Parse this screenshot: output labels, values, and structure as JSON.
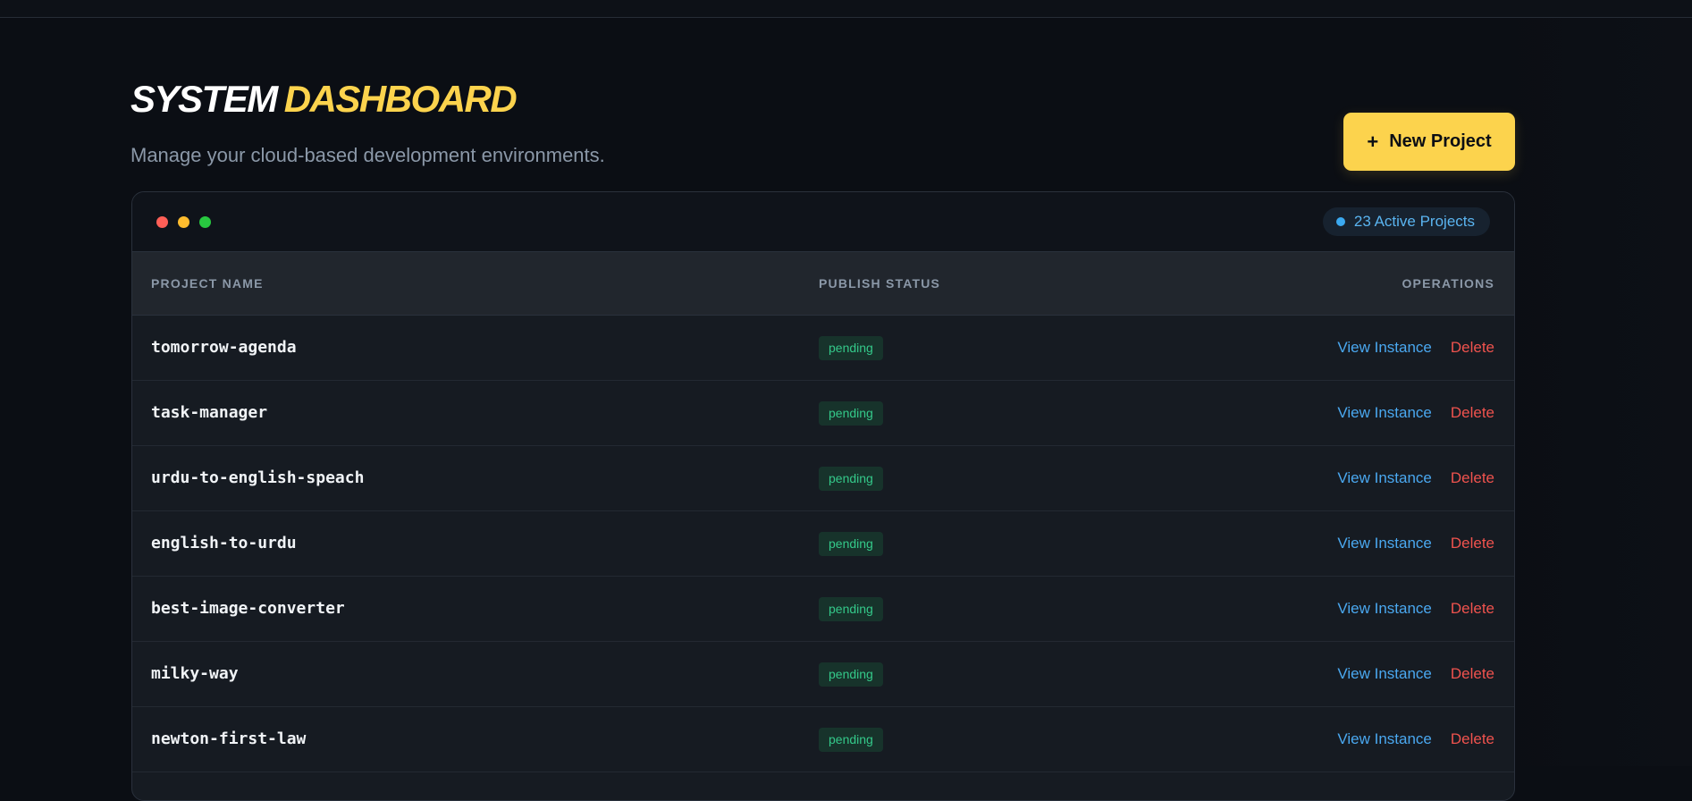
{
  "header": {
    "title_part1": "SYSTEM",
    "title_part2": "DASHBOARD",
    "subtitle": "Manage your cloud-based development environments.",
    "new_project_button": {
      "icon": "plus-icon",
      "icon_glyph": "+",
      "label": "New Project"
    }
  },
  "panel": {
    "window_dots": [
      "red",
      "yellow",
      "green"
    ],
    "active_projects_label": "23 Active Projects"
  },
  "table": {
    "columns": {
      "name": "PROJECT NAME",
      "status": "PUBLISH STATUS",
      "operations": "OPERATIONS"
    },
    "rows": [
      {
        "name": "tomorrow-agenda",
        "status": "pending",
        "view": "View Instance",
        "delete": "Delete"
      },
      {
        "name": "task-manager",
        "status": "pending",
        "view": "View Instance",
        "delete": "Delete"
      },
      {
        "name": "urdu-to-english-speach",
        "status": "pending",
        "view": "View Instance",
        "delete": "Delete"
      },
      {
        "name": "english-to-urdu",
        "status": "pending",
        "view": "View Instance",
        "delete": "Delete"
      },
      {
        "name": "best-image-converter",
        "status": "pending",
        "view": "View Instance",
        "delete": "Delete"
      },
      {
        "name": "milky-way",
        "status": "pending",
        "view": "View Instance",
        "delete": "Delete"
      },
      {
        "name": "newton-first-law",
        "status": "pending",
        "view": "View Instance",
        "delete": "Delete"
      }
    ]
  },
  "colors": {
    "background": "#0b0e14",
    "accent": "#fcd34d",
    "panel": "#161b22",
    "link": "#4aa8f0",
    "danger": "#f0534e",
    "status_pending": "#34c98a",
    "active_dot": "#3ba9f0"
  }
}
